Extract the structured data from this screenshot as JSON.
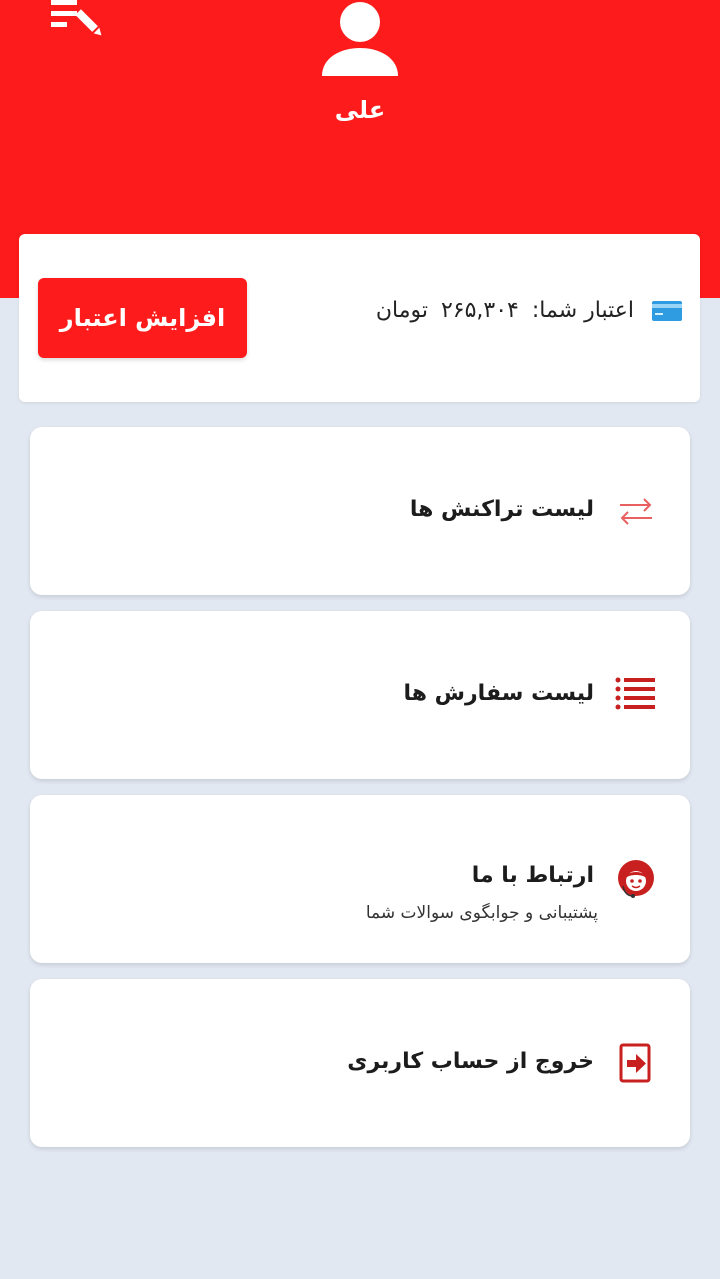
{
  "profile": {
    "name": "علی"
  },
  "credit": {
    "label": "اعتبار شما:",
    "amount": "۲۶۵,۳۰۴",
    "unit": "تومان",
    "increase_button": "افزایش اعتبار"
  },
  "menu": [
    {
      "label": "لیست تراکنش ها",
      "icon": "transfer-arrows-icon"
    },
    {
      "label": "لیست سفارش ها",
      "icon": "list-icon"
    },
    {
      "label": "ارتباط با ما",
      "sub": "پشتیبانی و جوابگوی سوالات شما",
      "icon": "support-agent-icon"
    },
    {
      "label": "خروج از حساب کاربری",
      "icon": "logout-icon"
    }
  ],
  "colors": {
    "accent": "#fe1b1b",
    "background": "#e2e8f2",
    "icon_red": "#c8201f"
  }
}
